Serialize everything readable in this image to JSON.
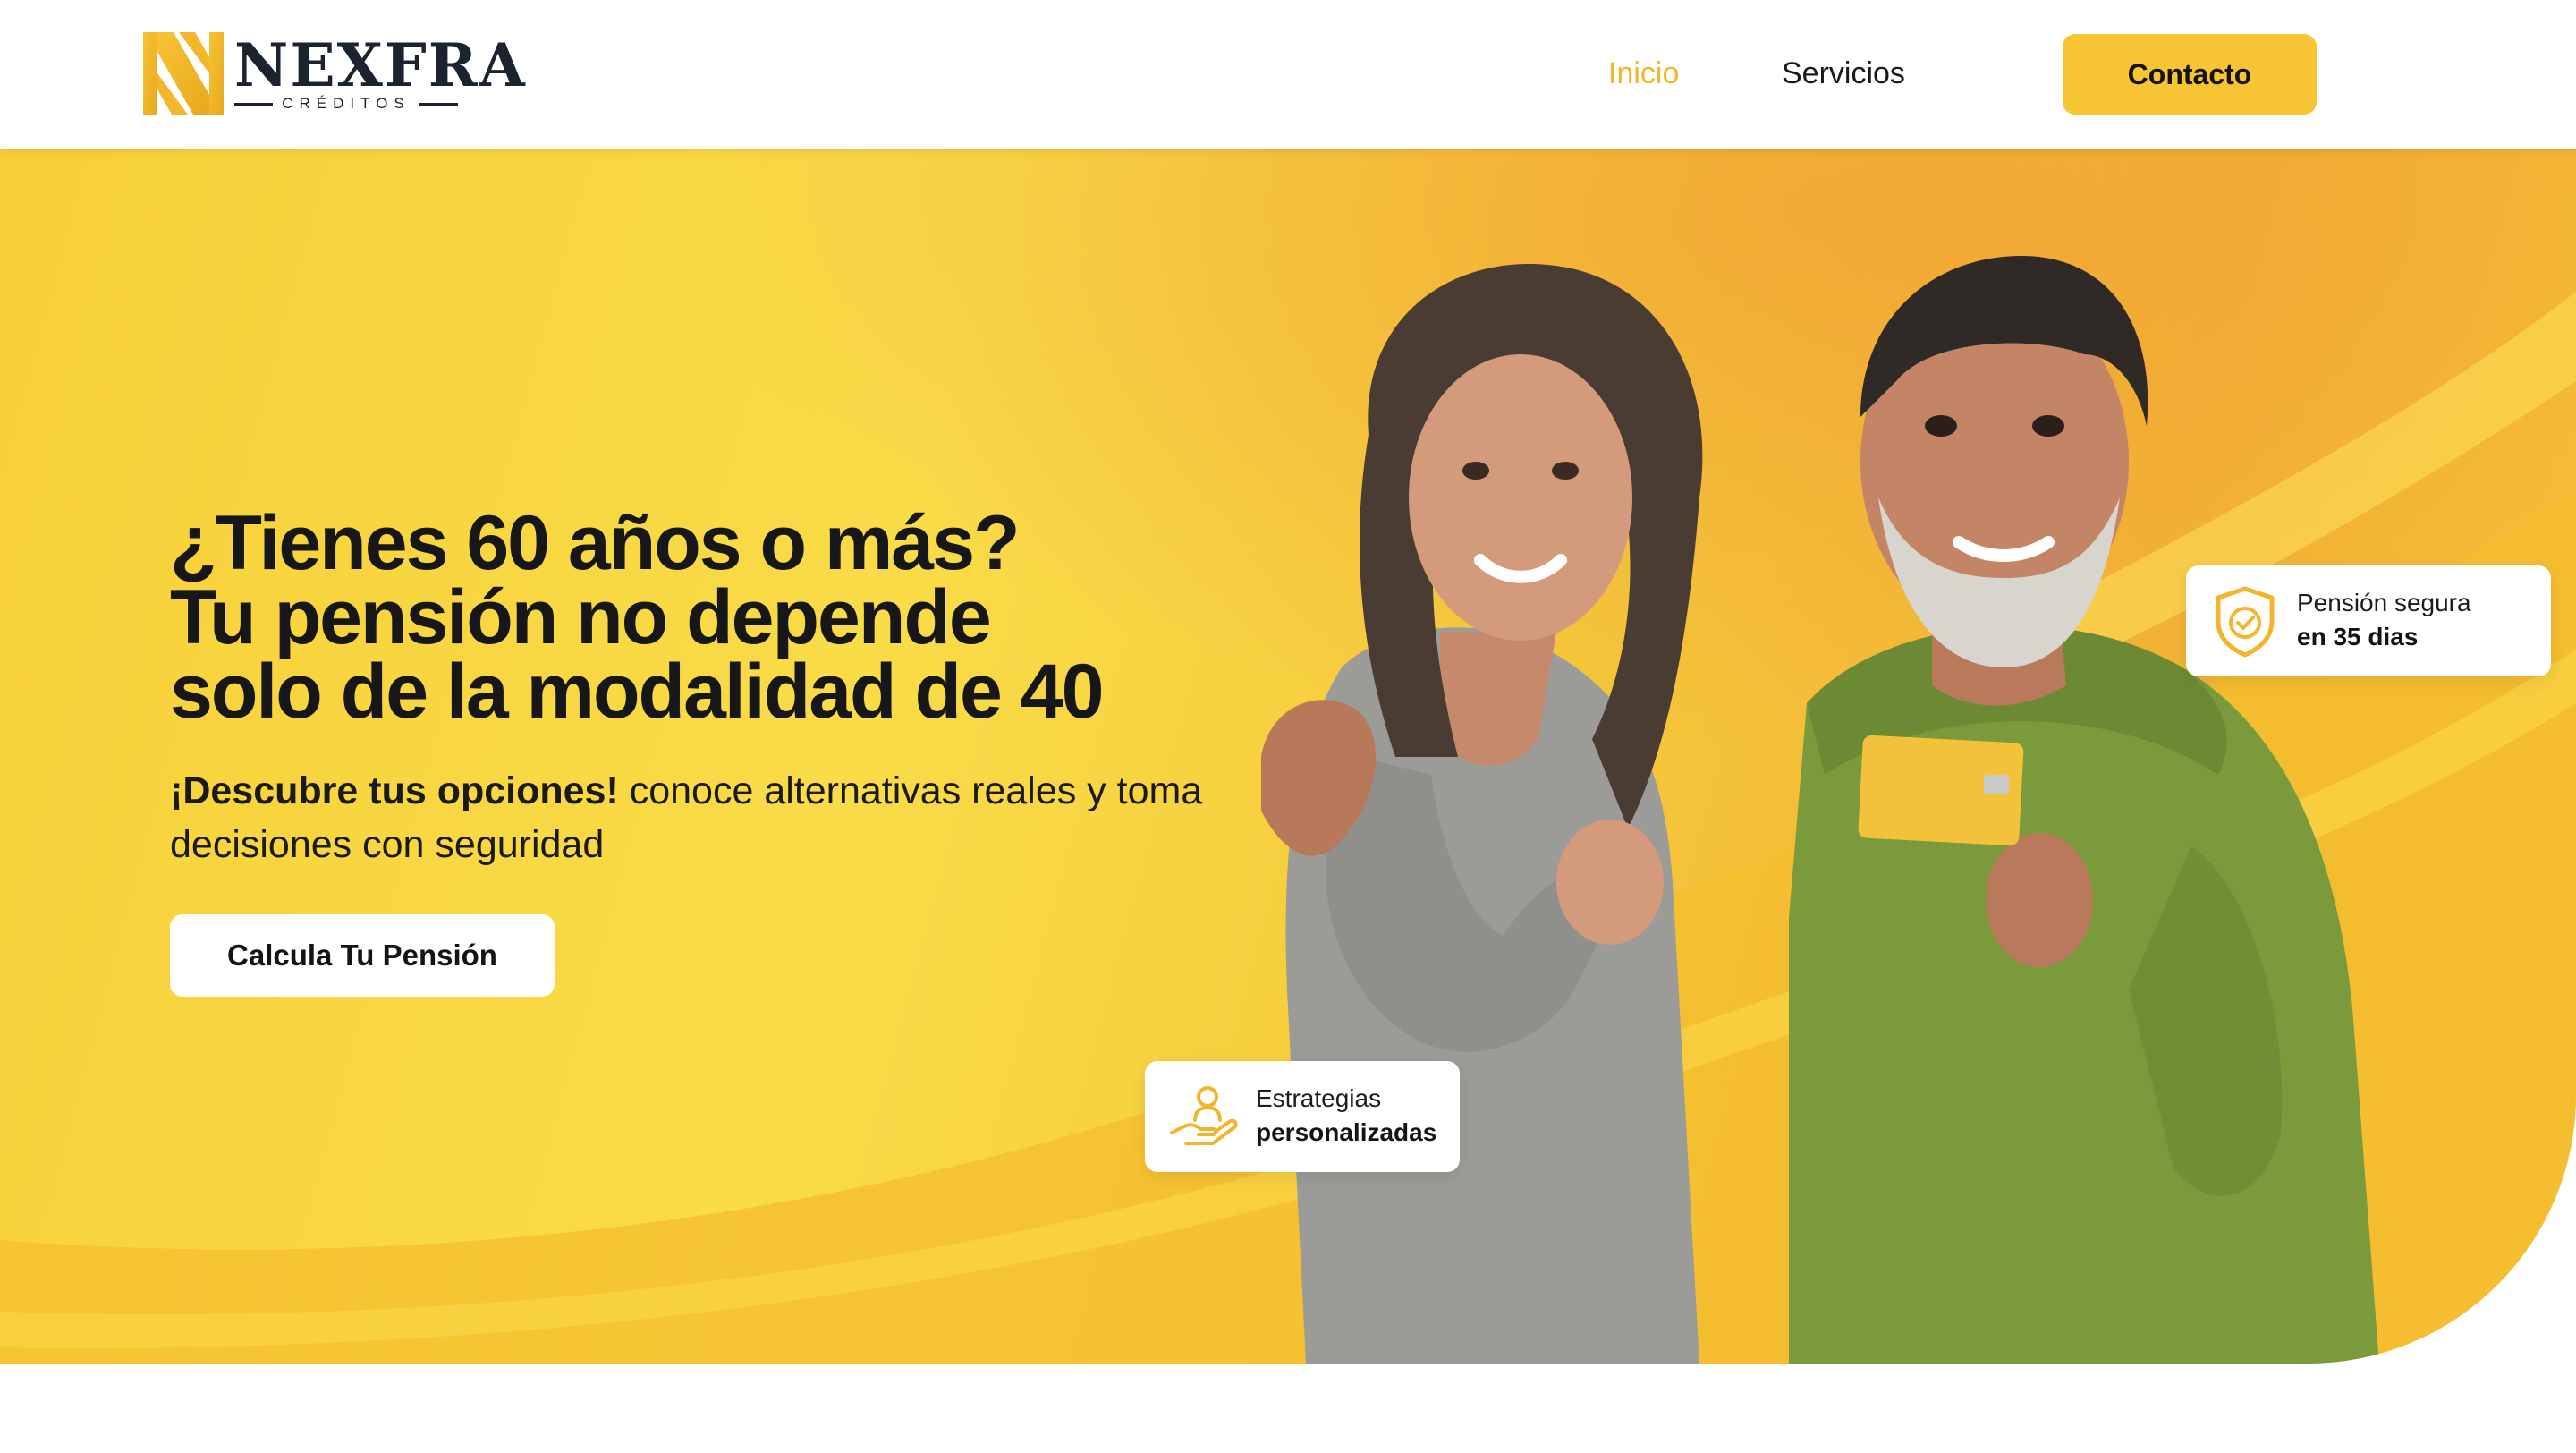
{
  "header": {
    "logo": {
      "name": "NEXFRA",
      "subtitle": "CRÉDITOS"
    },
    "nav": [
      {
        "label": "Inicio",
        "active": true
      },
      {
        "label": "Servicios",
        "active": false
      }
    ],
    "cta_label": "Contacto"
  },
  "hero": {
    "headline": [
      "¿Tienes 60 años o más?",
      "Tu pensión no depende",
      "solo de la modalidad de 40"
    ],
    "subtext_bold": "¡Descubre tus opciones!",
    "subtext_rest": " conoce alternativas reales y toma decisiones con seguridad",
    "button_label": "Calcula Tu Pensión",
    "cards": [
      {
        "icon": "shield-check-icon",
        "line1": "Pensión segura",
        "line2": "en 35 dias"
      },
      {
        "icon": "hand-person-icon",
        "line1": "Estrategias",
        "line2": "personalizadas"
      }
    ]
  },
  "colors": {
    "accent": "#f7c434",
    "active_nav": "#f2b52c",
    "hero_yellow": "#f9dc48",
    "hero_orange": "#f3b436",
    "text_dark": "#141414",
    "logo_navy": "#1c2330"
  }
}
